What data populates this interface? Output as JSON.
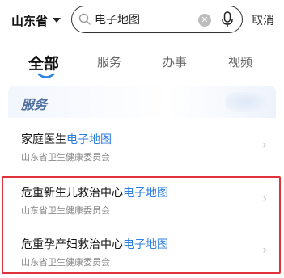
{
  "header": {
    "province": "山东省",
    "search_value": "电子地图",
    "cancel_label": "取消"
  },
  "tabs": [
    {
      "label": "全部",
      "active": true
    },
    {
      "label": "服务",
      "active": false
    },
    {
      "label": "办事",
      "active": false
    },
    {
      "label": "视频",
      "active": false
    }
  ],
  "section": {
    "title": "服务",
    "items": [
      {
        "title_prefix": "家庭医生",
        "title_highlight": "电子地图",
        "subtitle": "山东省卫生健康委员会"
      },
      {
        "title_prefix": "危重新生儿救治中心",
        "title_highlight": "电子地图",
        "subtitle": "山东省卫生健康委员会"
      },
      {
        "title_prefix": "危重孕产妇救治中心",
        "title_highlight": "电子地图",
        "subtitle": "山东省卫生健康委员会"
      }
    ]
  },
  "colors": {
    "highlight_text": "#2d7fe0",
    "annotation_box": "#e0323a",
    "section_title": "#4f6f9f"
  }
}
